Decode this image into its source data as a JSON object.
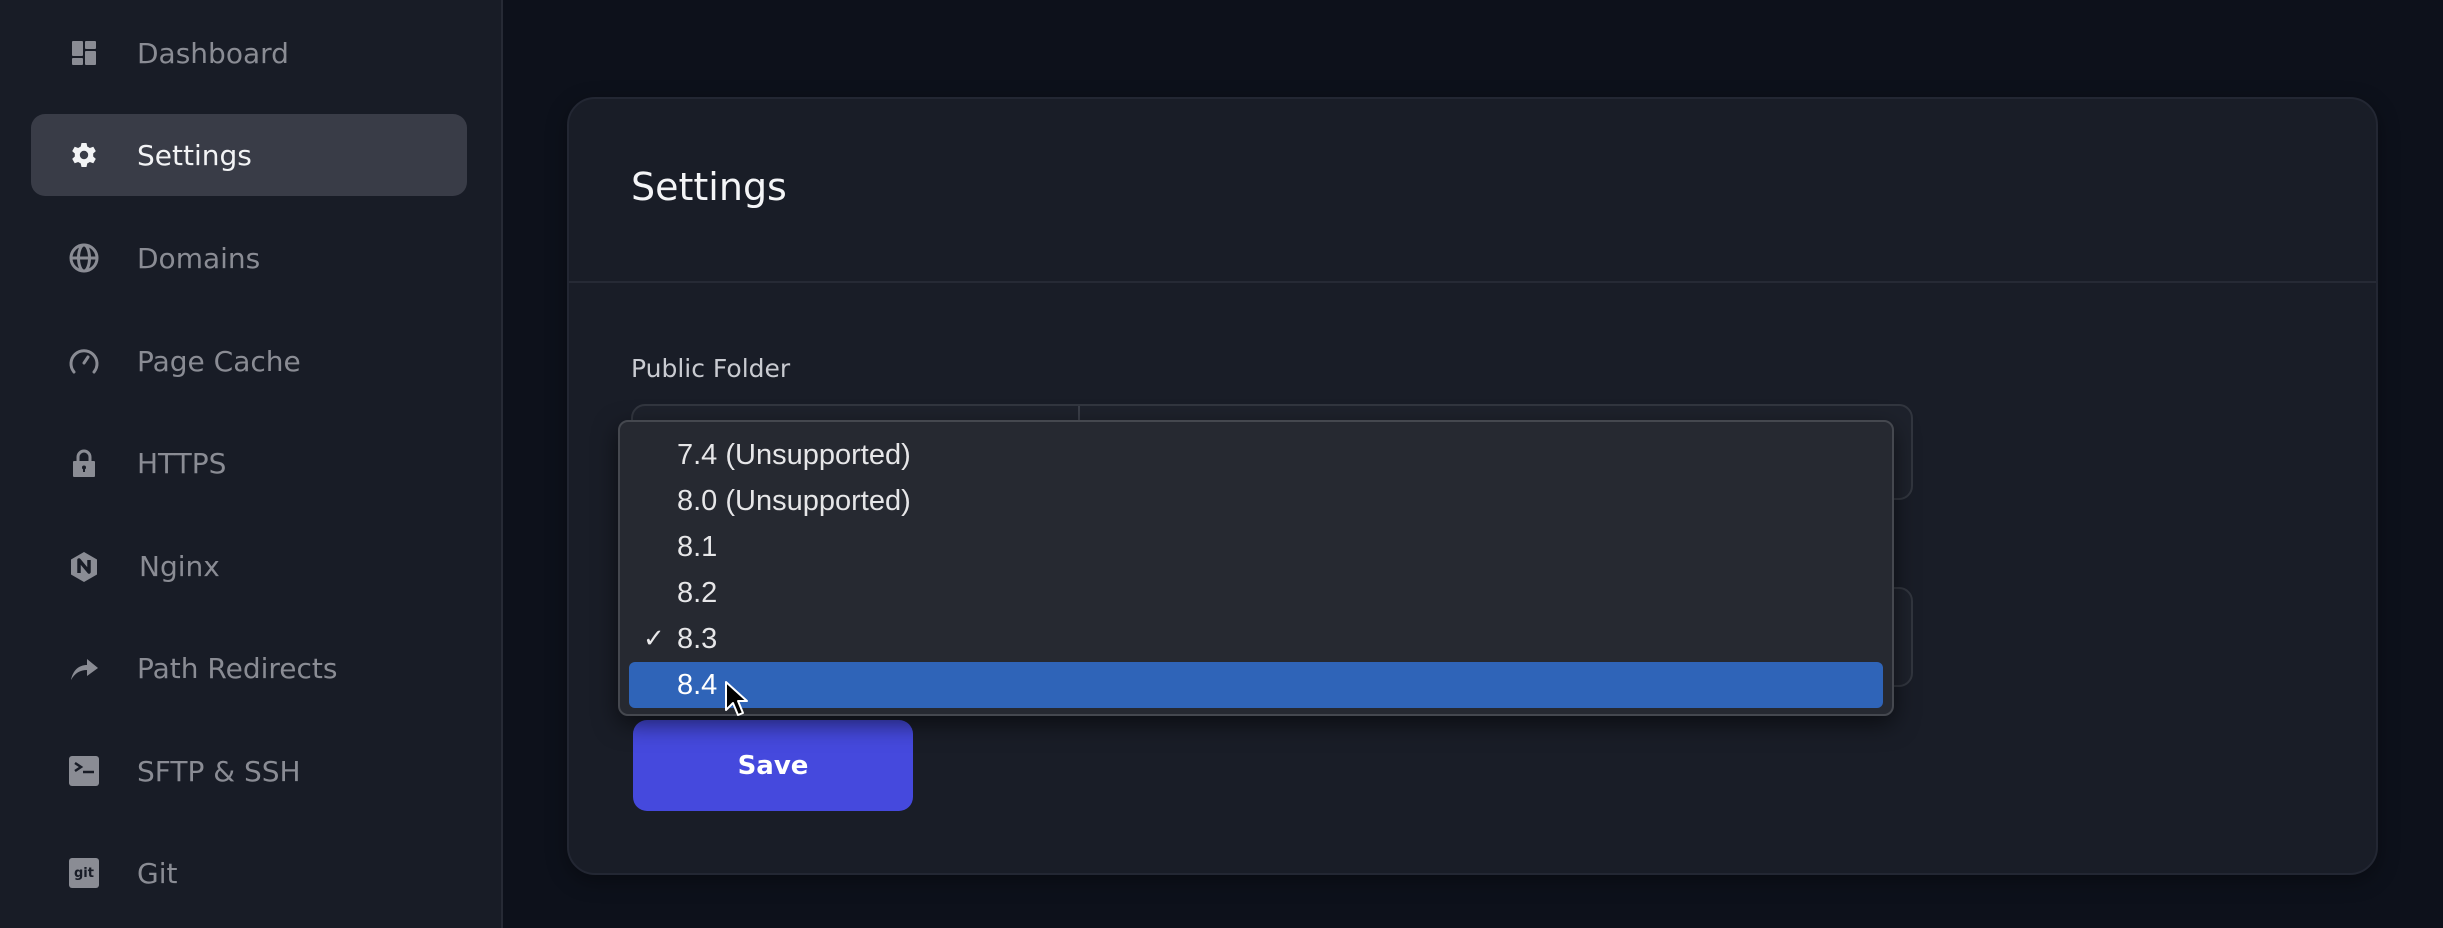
{
  "sidebar": {
    "items": [
      {
        "label": "Dashboard",
        "icon": "dashboard-icon",
        "active": false
      },
      {
        "label": "Settings",
        "icon": "gear-icon",
        "active": true
      },
      {
        "label": "Domains",
        "icon": "globe-icon",
        "active": false
      },
      {
        "label": "Page Cache",
        "icon": "gauge-icon",
        "active": false
      },
      {
        "label": "HTTPS",
        "icon": "lock-icon",
        "active": false
      },
      {
        "label": "Nginx",
        "icon": "nginx-icon",
        "active": false
      },
      {
        "label": "Path Redirects",
        "icon": "share-arrow-icon",
        "active": false
      },
      {
        "label": "SFTP & SSH",
        "icon": "terminal-icon",
        "active": false
      },
      {
        "label": "Git",
        "icon": "git-icon",
        "active": false
      }
    ]
  },
  "main": {
    "title": "Settings",
    "fields": {
      "public_folder_label": "Public Folder"
    },
    "save_label": "Save"
  },
  "php_version_dropdown": {
    "options": [
      {
        "label": "7.4 (Unsupported)",
        "checked": false,
        "highlighted": false
      },
      {
        "label": "8.0 (Unsupported)",
        "checked": false,
        "highlighted": false
      },
      {
        "label": "8.1",
        "checked": false,
        "highlighted": false
      },
      {
        "label": "8.2",
        "checked": false,
        "highlighted": false
      },
      {
        "label": "8.3",
        "checked": true,
        "highlighted": false
      },
      {
        "label": "8.4",
        "checked": false,
        "highlighted": true
      }
    ],
    "check_glyph": "✓"
  },
  "colors": {
    "accent": "#4549dd",
    "highlight": "#2f64b8",
    "sidebar_bg": "#181c26",
    "page_bg": "#0d111b",
    "card_bg": "#191d27"
  }
}
